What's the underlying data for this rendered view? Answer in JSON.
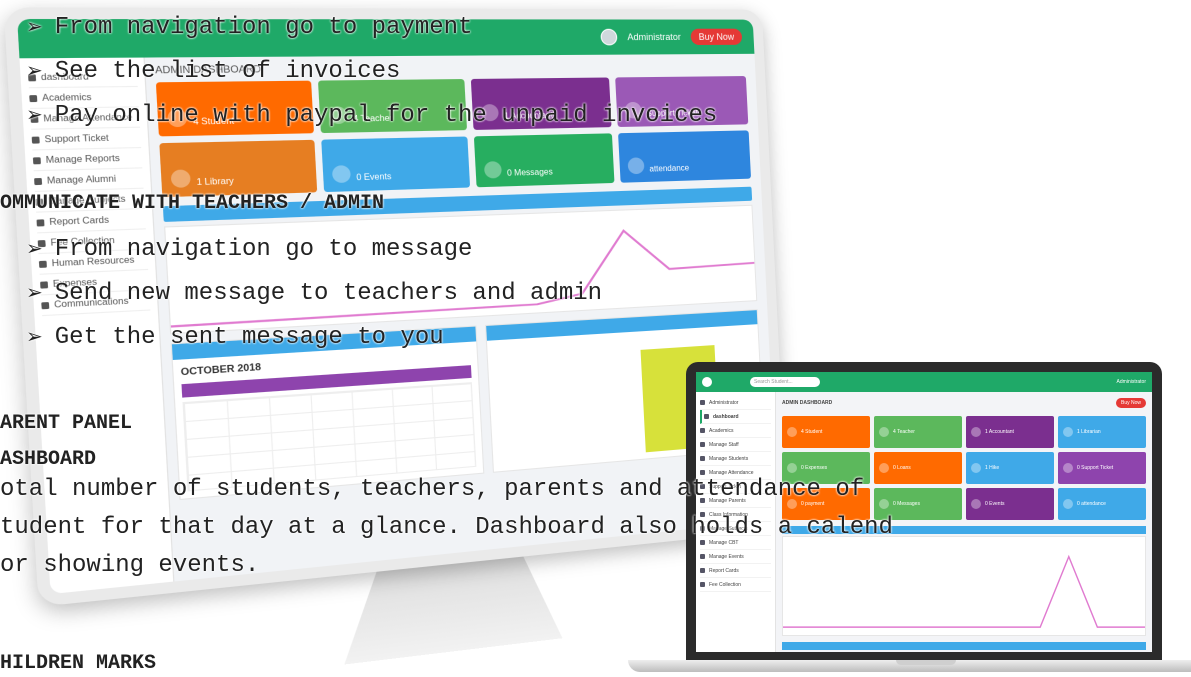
{
  "bullets_payment": [
    "From navigation go to payment",
    "See the list of invoices",
    "Pay online with paypal for the unpaid invoices"
  ],
  "heading_communicate": "OMMUNICATE WITH TEACHERS / ADMIN",
  "bullets_message": [
    "From navigation go to message",
    "Send new message to teachers and admin",
    "Get the sent message to you"
  ],
  "heading_parent_panel": "ARENT PANEL",
  "heading_dashboard": "ASHBOARD",
  "dashboard_text": [
    "otal number of students, teachers, parents and attendance of",
    "tudent for that day at a glance. Dashboard also holds a calend",
    "or showing events."
  ],
  "heading_children_marks": "HILDREN MARKS",
  "monitor": {
    "buy_now": "Buy Now",
    "admin_label": "Administrator",
    "page_title": "ADMIN DASHBOARD",
    "sidebar_items": [
      "dashboard",
      "Academics",
      "Manage Attendance",
      "Support Ticket",
      "Manage Reports",
      "Manage Alumni",
      "Manage Subjects",
      "Report Cards",
      "Fee Collection",
      "Human Resources",
      "Expenses",
      "Communications"
    ],
    "cards": [
      {
        "label": "4 Student",
        "color": "#ff6a00"
      },
      {
        "label": "4 Teacher",
        "color": "#5cb85c"
      },
      {
        "label": "1 Accountant",
        "color": "#7b2f8f"
      },
      {
        "label": "Support Ticket",
        "color": "#9b59b6"
      },
      {
        "label": "1 Library",
        "color": "#e67e22"
      },
      {
        "label": "0 Events",
        "color": "#3fa9e8"
      },
      {
        "label": "0 Messages",
        "color": "#27ae60"
      },
      {
        "label": "attendance",
        "color": "#2e86de"
      }
    ],
    "calendar_month": "OCTOBER 2018"
  },
  "laptop": {
    "search_placeholder": "Search Student...",
    "admin_label": "Administrator",
    "page_title": "ADMIN DASHBOARD",
    "buy_now": "Buy Now",
    "sidebar_items": [
      "Administrator",
      "dashboard",
      "Academics",
      "Manage Staff",
      "Manage Students",
      "Manage Attendance",
      "Support Ticket",
      "Manage Parents",
      "Class Information",
      "Manage Subjects",
      "Manage CBT",
      "Manage Events",
      "Report Cards",
      "Fee Collection"
    ],
    "cards": [
      {
        "label": "4 Student",
        "color": "#ff6a00"
      },
      {
        "label": "4 Teacher",
        "color": "#5cb85c"
      },
      {
        "label": "1 Accountant",
        "color": "#7b2f8f"
      },
      {
        "label": "1 Librarian",
        "color": "#3fa9e8"
      },
      {
        "label": "0 Expenses",
        "color": "#5cb85c"
      },
      {
        "label": "0 Loans",
        "color": "#ff6a00"
      },
      {
        "label": "1 Hike",
        "color": "#3fa9e8"
      },
      {
        "label": "0 Support Ticket",
        "color": "#8e44ad"
      },
      {
        "label": "0 payment",
        "color": "#ff6a00"
      },
      {
        "label": "0 Messages",
        "color": "#5cb85c"
      },
      {
        "label": "0 Events",
        "color": "#7b2f8f"
      },
      {
        "label": "0 attendance",
        "color": "#3fa9e8"
      }
    ]
  }
}
